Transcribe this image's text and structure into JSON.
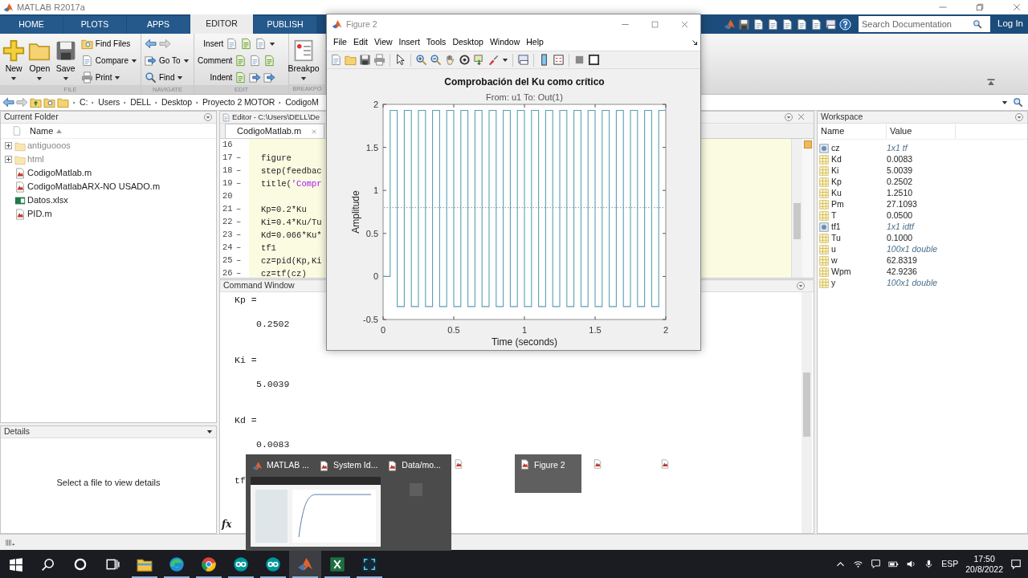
{
  "window": {
    "title": "MATLAB R2017a"
  },
  "ribbon_tabs": [
    {
      "label": "HOME",
      "selected": false
    },
    {
      "label": "PLOTS",
      "selected": false
    },
    {
      "label": "APPS",
      "selected": false
    },
    {
      "label": "EDITOR",
      "selected": true
    },
    {
      "label": "PUBLISH",
      "selected": false
    }
  ],
  "search": {
    "placeholder": "Search Documentation"
  },
  "login": "Log In",
  "toolstrip": [
    {
      "label": "FILE",
      "columns": [
        {
          "kind": "large",
          "label": "New",
          "dropdown": true
        },
        {
          "kind": "large",
          "label": "Open",
          "dropdown": true
        },
        {
          "kind": "large",
          "label": "Save",
          "dropdown": true
        },
        {
          "kind": "stack",
          "rows": [
            {
              "kind": "icon-first",
              "label": "Find Files",
              "dropdown": false
            },
            {
              "kind": "icon-first",
              "label": "Compare",
              "dropdown": true
            },
            {
              "kind": "icon-first",
              "label": "Print",
              "dropdown": true
            }
          ]
        }
      ]
    },
    {
      "label": "NAVIGATE",
      "columns": [
        {
          "kind": "stack",
          "rows": [
            {
              "kind": "icons",
              "dropdown": false
            },
            {
              "kind": "icon-first",
              "label": "Go To",
              "dropdown": true
            },
            {
              "kind": "icon-first",
              "label": "Find",
              "dropdown": true
            }
          ]
        }
      ]
    },
    {
      "label": "EDIT",
      "columns": [
        {
          "kind": "stack",
          "rows": [
            {
              "kind": "label-first",
              "label": "Insert",
              "dropdown": true
            },
            {
              "kind": "label-first",
              "label": "Comment",
              "dropdown": false
            },
            {
              "kind": "label-first",
              "label": "Indent",
              "dropdown": false
            }
          ]
        }
      ]
    },
    {
      "label": "BREAKPO",
      "columns": [
        {
          "kind": "large",
          "label": "Breakpo",
          "dropdown": true
        }
      ]
    }
  ],
  "address_path": [
    "C:",
    "Users",
    "DELL",
    "Desktop",
    "Proyecto 2 MOTOR",
    "CodigoM"
  ],
  "current_folder": {
    "title": "Current Folder",
    "column": "Name",
    "items": [
      {
        "name": "antiguooos",
        "kind": "folder",
        "expanded": false,
        "dimmed": true
      },
      {
        "name": "html",
        "kind": "folder",
        "expanded": false,
        "dimmed": true
      },
      {
        "name": "CodigoMatlab.m",
        "kind": "script",
        "dimmed": false
      },
      {
        "name": "CodigoMatlabARX-NO USADO.m",
        "kind": "script",
        "dimmed": false
      },
      {
        "name": "Datos.xlsx",
        "kind": "spreadsheet",
        "dimmed": false
      },
      {
        "name": "PID.m",
        "kind": "script",
        "dimmed": false
      }
    ]
  },
  "details": {
    "title": "Details",
    "message": "Select a file to view details"
  },
  "editor": {
    "title": "Editor - C:\\Users\\DELL\\De",
    "tabs": [
      {
        "label": "CodigoMatlab.m",
        "selected": true
      }
    ],
    "lines": [
      {
        "number": "16"
      },
      {
        "number": "17",
        "marker": "–",
        "code": "figure"
      },
      {
        "number": "18",
        "marker": "–",
        "code": "step(feedbac"
      },
      {
        "number": "19",
        "marker": "–",
        "code": "title('Compr"
      },
      {
        "number": "20"
      },
      {
        "number": "21",
        "marker": "–",
        "code": "Kp=0.2*Ku"
      },
      {
        "number": "22",
        "marker": "–",
        "code": "Ki=0.4*Ku/Tu"
      },
      {
        "number": "23",
        "marker": "–",
        "code": "Kd=0.066*Ku*"
      },
      {
        "number": "24",
        "marker": "–",
        "code": "tf1"
      },
      {
        "number": "25",
        "marker": "–",
        "code": "cz=pid(Kp,Ki"
      },
      {
        "number": "26",
        "marker": "–",
        "code": "cz=tf(cz)"
      }
    ]
  },
  "command_window": {
    "title": "Command Window",
    "prompt": "fx",
    "lines": [
      {
        "kind": "name",
        "text": "Kp ="
      },
      {
        "kind": "value",
        "text": "0.2502"
      },
      {
        "kind": "name",
        "text": "Ki ="
      },
      {
        "kind": "value",
        "text": "5.0039"
      },
      {
        "kind": "name",
        "text": "Kd ="
      },
      {
        "kind": "value",
        "text": "0.0083"
      },
      {
        "kind": "name",
        "text": "tf"
      }
    ]
  },
  "workspace": {
    "title": "Workspace",
    "columns": [
      "Name",
      "Value"
    ],
    "rows": [
      {
        "name": "cz",
        "value": "1x1 tf",
        "kind": "object"
      },
      {
        "name": "Kd",
        "value": "0.0083",
        "kind": "scalar"
      },
      {
        "name": "Ki",
        "value": "5.0039",
        "kind": "scalar"
      },
      {
        "name": "Kp",
        "value": "0.2502",
        "kind": "scalar"
      },
      {
        "name": "Ku",
        "value": "1.2510",
        "kind": "scalar"
      },
      {
        "name": "Pm",
        "value": "27.1093",
        "kind": "scalar"
      },
      {
        "name": "T",
        "value": "0.0500",
        "kind": "scalar"
      },
      {
        "name": "tf1",
        "value": "1x1 idtf",
        "kind": "object"
      },
      {
        "name": "Tu",
        "value": "0.1000",
        "kind": "scalar"
      },
      {
        "name": "u",
        "value": "100x1 double",
        "kind": "array"
      },
      {
        "name": "w",
        "value": "62.8319",
        "kind": "scalar"
      },
      {
        "name": "Wpm",
        "value": "42.9236",
        "kind": "scalar"
      },
      {
        "name": "y",
        "value": "100x1 double",
        "kind": "array"
      }
    ]
  },
  "figure": {
    "title": "Figure 2",
    "menu": [
      "File",
      "Edit",
      "View",
      "Insert",
      "Tools",
      "Desktop",
      "Window",
      "Help"
    ],
    "subtitle": "From: u1  To: Out(1)",
    "chart_data": {
      "type": "line",
      "title": "Comprobación del Ku como crítico",
      "xlabel": "Time (seconds)",
      "ylabel": "Amplitude",
      "xlim": [
        0,
        2
      ],
      "ylim": [
        -0.5,
        2
      ],
      "xticks": [
        0,
        0.5,
        1,
        1.5,
        2
      ],
      "yticks": [
        -0.5,
        0,
        0.5,
        1,
        1.5,
        2
      ],
      "x": [
        0,
        0.05,
        0.05,
        0.1,
        0.1,
        0.15,
        0.15,
        0.2,
        0.2,
        0.25,
        0.25,
        0.3,
        0.3,
        0.35,
        0.35,
        0.4,
        0.4,
        0.45,
        0.45,
        0.5,
        0.5,
        0.55,
        0.55,
        0.6,
        0.6,
        0.65,
        0.65,
        0.7,
        0.7,
        0.75,
        0.75,
        0.8,
        0.8,
        0.85,
        0.85,
        0.9,
        0.9,
        0.95,
        0.95,
        1,
        1,
        1.05,
        1.05,
        1.1,
        1.1,
        1.15,
        1.15,
        1.2,
        1.2,
        1.25,
        1.25,
        1.3,
        1.3,
        1.35,
        1.35,
        1.4,
        1.4,
        1.45,
        1.45,
        1.5,
        1.5,
        1.55,
        1.55,
        1.6,
        1.6,
        1.65,
        1.65,
        1.7,
        1.7,
        1.75,
        1.75,
        1.8,
        1.8,
        1.85,
        1.85,
        1.9,
        1.9,
        1.95,
        1.95,
        2
      ],
      "series": [
        {
          "color": "#5a9fb4",
          "values": [
            0,
            0,
            1.93,
            1.93,
            -0.35,
            -0.35,
            1.93,
            1.93,
            -0.35,
            -0.35,
            1.93,
            1.93,
            -0.35,
            -0.35,
            1.93,
            1.93,
            -0.35,
            -0.35,
            1.93,
            1.93,
            -0.35,
            -0.35,
            1.93,
            1.93,
            -0.35,
            -0.35,
            1.93,
            1.93,
            -0.35,
            -0.35,
            1.93,
            1.93,
            -0.35,
            -0.35,
            1.93,
            1.93,
            -0.35,
            -0.35,
            1.93,
            1.93,
            -0.35,
            -0.35,
            1.93,
            1.93,
            -0.35,
            -0.35,
            1.93,
            1.93,
            -0.35,
            -0.35,
            1.93,
            1.93,
            -0.35,
            -0.35,
            1.93,
            1.93,
            -0.35,
            -0.35,
            1.93,
            1.93,
            -0.35,
            -0.35,
            1.93,
            1.93,
            -0.35,
            -0.35,
            1.93,
            1.93,
            -0.35,
            -0.35,
            1.93,
            1.93,
            -0.35,
            -0.35,
            1.93,
            1.93,
            -0.35,
            -0.35,
            1.93,
            1.93
          ]
        }
      ],
      "ref_lines": [
        {
          "axis": "y",
          "value": 0.8
        }
      ]
    }
  },
  "window_previews": [
    {
      "label": "MATLAB ...",
      "selected": false
    },
    {
      "label": "System Id...",
      "selected": false
    },
    {
      "label": "Data/mo...",
      "selected": false
    },
    {
      "label": "Figure 2",
      "selected": true
    }
  ],
  "taskbar": {
    "apps": [
      {
        "kind": "explorer",
        "running": true,
        "active": false
      },
      {
        "kind": "edge",
        "running": true,
        "active": false
      },
      {
        "kind": "chrome",
        "running": true,
        "active": false
      },
      {
        "kind": "arduino",
        "running": true,
        "active": false
      },
      {
        "kind": "arduino",
        "running": true,
        "active": false
      },
      {
        "kind": "matlab",
        "running": true,
        "active": true
      },
      {
        "kind": "excel",
        "running": true,
        "active": false
      },
      {
        "kind": "capture",
        "running": true,
        "active": false
      }
    ],
    "language": "ESP",
    "time": "17:50",
    "date": "20/8/2022"
  }
}
